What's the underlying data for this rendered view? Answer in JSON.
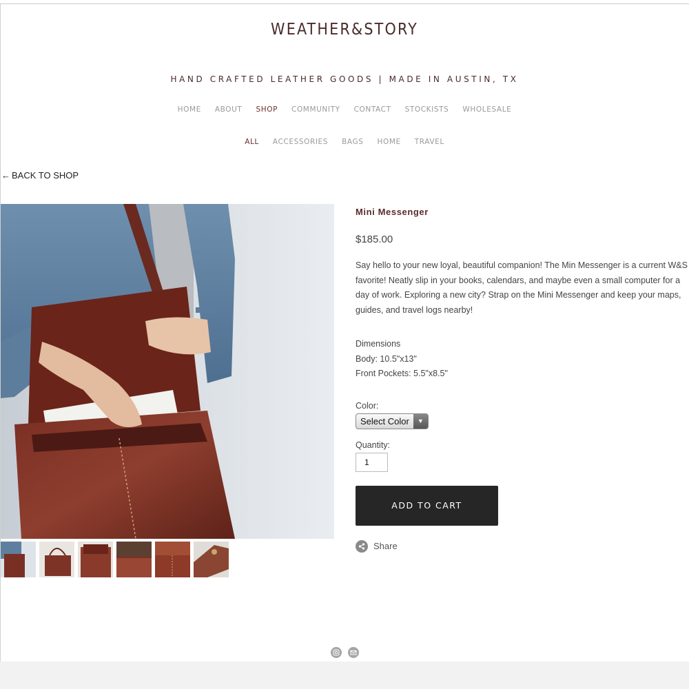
{
  "brand": {
    "logo": "WEATHER&STORY",
    "tagline": "HAND CRAFTED LEATHER GOODS | MADE IN AUSTIN, TX"
  },
  "main_nav": [
    {
      "label": "HOME",
      "active": false
    },
    {
      "label": "ABOUT",
      "active": false
    },
    {
      "label": "SHOP",
      "active": true
    },
    {
      "label": "COMMUNITY",
      "active": false
    },
    {
      "label": "CONTACT",
      "active": false
    },
    {
      "label": "STOCKISTS",
      "active": false
    },
    {
      "label": "WHOLESALE",
      "active": false
    }
  ],
  "sub_nav": [
    {
      "label": "ALL",
      "active": true
    },
    {
      "label": "ACCESSORIES",
      "active": false
    },
    {
      "label": "BAGS",
      "active": false
    },
    {
      "label": "HOME",
      "active": false
    },
    {
      "label": "TRAVEL",
      "active": false
    }
  ],
  "back_link": {
    "arrow": "←",
    "label": "BACK TO SHOP"
  },
  "product": {
    "title": "Mini Messenger",
    "price": "$185.00",
    "description": "Say hello to your new loyal, beautiful companion!  The Min Messenger is a current W&S favorite!  Neatly slip in your books, calendars, and maybe even a small computer for a day of work.  Exploring a new city? Strap on the Mini Messenger and keep your maps, guides, and travel logs nearby!",
    "dimensions_heading": "Dimensions",
    "dimensions_body": "Body: 10.5\"x13\"",
    "dimensions_pockets": "Front Pockets: 5.5\"x8.5\"",
    "color_label": "Color:",
    "color_select": "Select Color",
    "quantity_label": "Quantity:",
    "quantity_value": "1",
    "add_to_cart": "ADD TO CART",
    "share_label": "Share"
  },
  "thumbnails": [
    "bag-worn",
    "bag-front",
    "bag-open",
    "bag-top-detail",
    "bag-pockets",
    "bag-strap-detail"
  ],
  "footer_icons": [
    "instagram-icon",
    "email-icon"
  ],
  "colors": {
    "accent": "#6b2e2e",
    "button": "#262626",
    "nav": "#999999"
  }
}
